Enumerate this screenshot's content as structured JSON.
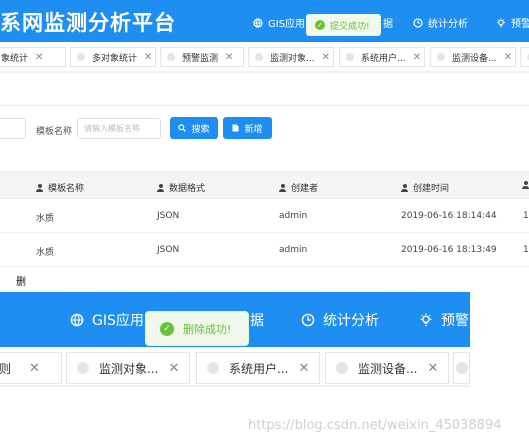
{
  "top": {
    "title": "系网监测分析平台",
    "nav": [
      "GIS应用",
      "数据",
      "统计分析",
      "预警"
    ],
    "toast": "提交成功!"
  },
  "tabs_small": [
    {
      "label": "象统计"
    },
    {
      "label": "多对象统计"
    },
    {
      "label": "预警监测"
    },
    {
      "label": "监测对象..."
    },
    {
      "label": "系统用户..."
    },
    {
      "label": "监测设备..."
    }
  ],
  "search": {
    "label": "模板名称",
    "placeholder": "请输入模板名称",
    "search_btn": "搜索",
    "add_btn": "新增"
  },
  "table": {
    "headers": [
      "模板名称",
      "数据格式",
      "创建者",
      "创建时间",
      ""
    ],
    "rows": [
      [
        "水质",
        "JSON",
        "admin",
        "2019-06-16 18:14:44",
        "1"
      ],
      [
        "水质",
        "JSON",
        "admin",
        "2019-06-16 18:13:49",
        "1"
      ]
    ]
  },
  "stray_char": "删",
  "second": {
    "nav": [
      "GIS应用",
      "据",
      "统计分析",
      "预警"
    ],
    "toast": "删除成功!",
    "tabs": [
      {
        "label": "则"
      },
      {
        "label": "监测对象..."
      },
      {
        "label": "系统用户..."
      },
      {
        "label": "监测设备..."
      }
    ]
  },
  "watermark": "https://blog.csdn.net/weixin_45038894",
  "colors": {
    "brand": "#1e8ff0",
    "success": "#67c23a"
  }
}
